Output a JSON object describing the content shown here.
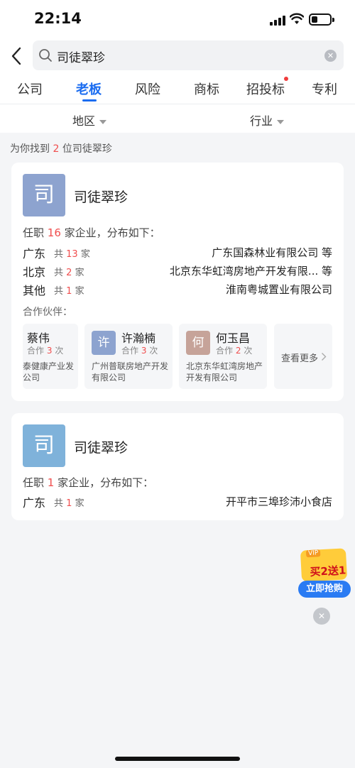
{
  "status": {
    "time": "22:14"
  },
  "search": {
    "query": "司徒翠珍"
  },
  "tabs": [
    {
      "label": "公司"
    },
    {
      "label": "老板"
    },
    {
      "label": "风险"
    },
    {
      "label": "商标"
    },
    {
      "label": "招投标"
    },
    {
      "label": "专利"
    }
  ],
  "active_tab": "老板",
  "filters": {
    "region": "地区",
    "industry": "行业"
  },
  "result": {
    "prefix": "为你找到",
    "count": "2",
    "suffix": "位司徒翠珍"
  },
  "cards": [
    {
      "avatar_char": "司",
      "avatar_color": "#8da3cf",
      "name": "司徒翠珍",
      "summary_prefix": "任职",
      "summary_count": "16",
      "summary_suffix": "家企业，分布如下：",
      "regions": [
        {
          "name": "广东",
          "count_prefix": "共",
          "count": "13",
          "count_suffix": "家",
          "company": "广东国森林业有限公司 等"
        },
        {
          "name": "北京",
          "count_prefix": "共",
          "count": "2",
          "count_suffix": "家",
          "company": "北京东华虹湾房地产开发有限... 等"
        },
        {
          "name": "其他",
          "count_prefix": "共",
          "count": "1",
          "count_suffix": "家",
          "company": "淮南粤城置业有限公司"
        }
      ],
      "partners_label": "合作伙伴：",
      "partners": [
        {
          "avatar_char": "",
          "name": "蔡伟",
          "collab_prefix": "合作",
          "collab_count": "3",
          "collab_suffix": "次",
          "company_line1": "泰健康产业发",
          "company_line2": "公司"
        },
        {
          "avatar_char": "许",
          "avatar_color": "#8da3cf",
          "name": "许瀚楠",
          "collab_prefix": "合作",
          "collab_count": "3",
          "collab_suffix": "次",
          "company_line1": "广州普联房地产开发",
          "company_line2": "有限公司"
        },
        {
          "avatar_char": "何",
          "avatar_color": "#c6a399",
          "name": "何玉昌",
          "collab_prefix": "合作",
          "collab_count": "2",
          "collab_suffix": "次",
          "company_line1": "北京东华虹湾房地产",
          "company_line2": "开发有限公司"
        }
      ],
      "see_more": "查看更多"
    },
    {
      "avatar_char": "司",
      "avatar_color": "#7fb2da",
      "name": "司徒翠珍",
      "summary_prefix": "任职",
      "summary_count": "1",
      "summary_suffix": "家企业，分布如下：",
      "regions": [
        {
          "name": "广东",
          "count_prefix": "共",
          "count": "1",
          "count_suffix": "家",
          "company": "开平市三埠珍沛小食店"
        }
      ]
    }
  ],
  "promo": {
    "badge": "VIP",
    "headline": "买2送1",
    "button": "立即抢购"
  }
}
